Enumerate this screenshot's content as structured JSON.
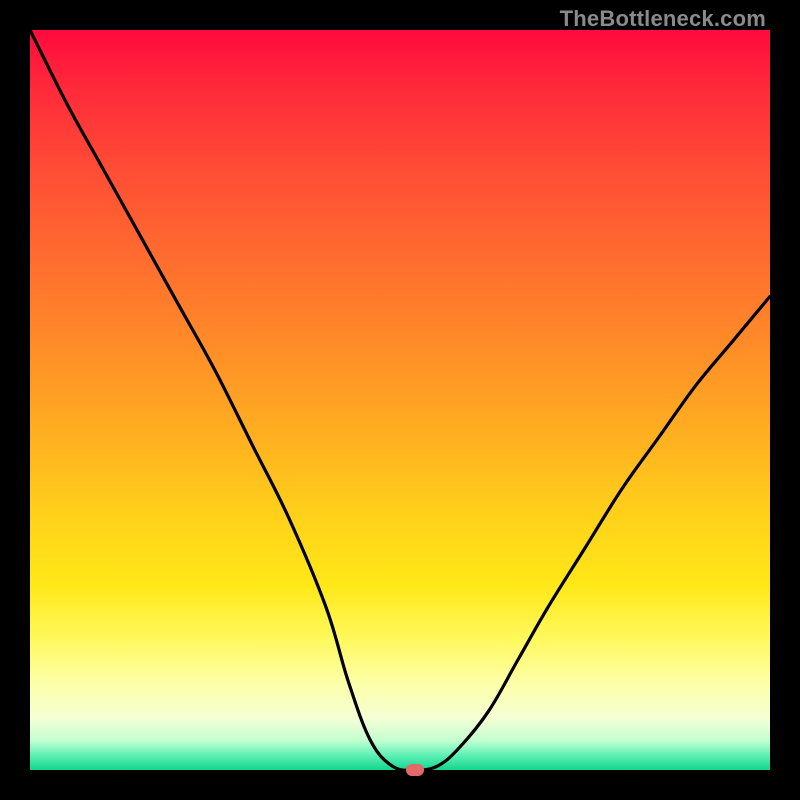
{
  "watermark": "TheBottleneck.com",
  "colors": {
    "frame": "#000000",
    "curve_stroke": "#000000",
    "marker_fill": "#e46a6a",
    "watermark_text": "#8a8a8a"
  },
  "chart_data": {
    "type": "line",
    "title": "",
    "xlabel": "",
    "ylabel": "",
    "xlim": [
      0,
      100
    ],
    "ylim": [
      0,
      100
    ],
    "grid": false,
    "legend": false,
    "series": [
      {
        "name": "curve",
        "x": [
          0,
          5,
          10,
          15,
          20,
          25,
          30,
          35,
          40,
          43,
          46,
          49,
          52,
          55,
          58,
          62,
          66,
          70,
          75,
          80,
          85,
          90,
          95,
          100
        ],
        "values": [
          100,
          90,
          81,
          72,
          63,
          54,
          44,
          34,
          22,
          12,
          4,
          0.5,
          0,
          0.5,
          3,
          8,
          15,
          22,
          30,
          38,
          45,
          52,
          58,
          64
        ]
      }
    ],
    "marker": {
      "x": 52,
      "y": 0
    },
    "gradient_stops": [
      {
        "pos": 0,
        "color": "#ff0a3d"
      },
      {
        "pos": 18,
        "color": "#ff4a36"
      },
      {
        "pos": 42,
        "color": "#ff8a28"
      },
      {
        "pos": 66,
        "color": "#ffd21a"
      },
      {
        "pos": 88,
        "color": "#fdffa5"
      },
      {
        "pos": 98,
        "color": "#5ef0b5"
      },
      {
        "pos": 100,
        "color": "#14d68c"
      }
    ]
  }
}
